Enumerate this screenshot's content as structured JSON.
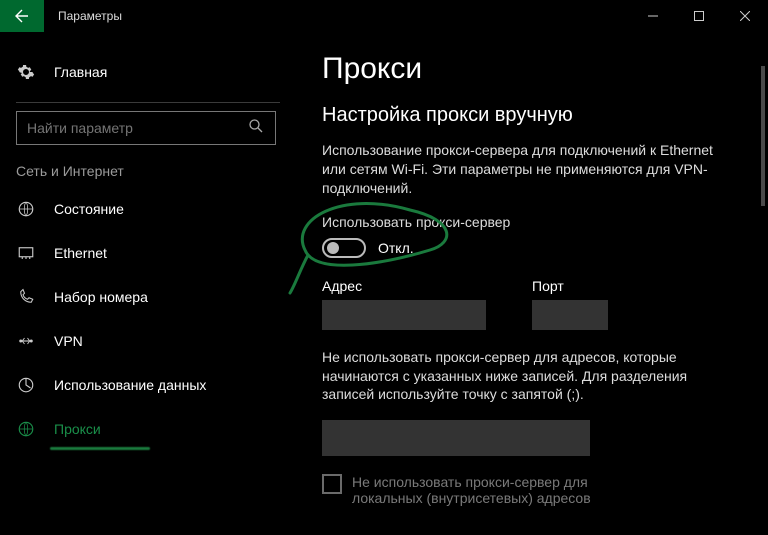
{
  "window": {
    "title": "Параметры"
  },
  "sidebar": {
    "home": "Главная",
    "search_placeholder": "Найти параметр",
    "section": "Сеть и Интернет",
    "items": [
      {
        "label": "Состояние"
      },
      {
        "label": "Ethernet"
      },
      {
        "label": "Набор номера"
      },
      {
        "label": "VPN"
      },
      {
        "label": "Использование данных"
      },
      {
        "label": "Прокси"
      }
    ]
  },
  "main": {
    "title": "Прокси",
    "subtitle": "Настройка прокси вручную",
    "desc": "Использование прокси-сервера для подключений к Ethernet или сетям Wi-Fi. Эти параметры не применяются для VPN-подключений.",
    "use_proxy_label": "Использовать прокси-сервер",
    "toggle_state": "Откл.",
    "addr_label": "Адрес",
    "port_label": "Порт",
    "addr_value": "",
    "port_value": "",
    "bypass_desc": "Не использовать прокси-сервер для адресов, которые начинаются с указанных ниже записей. Для разделения записей используйте точку с запятой (;).",
    "bypass_value": "",
    "dont_use_local": "Не использовать прокси-сервер для локальных (внутрисетевых) адресов"
  }
}
